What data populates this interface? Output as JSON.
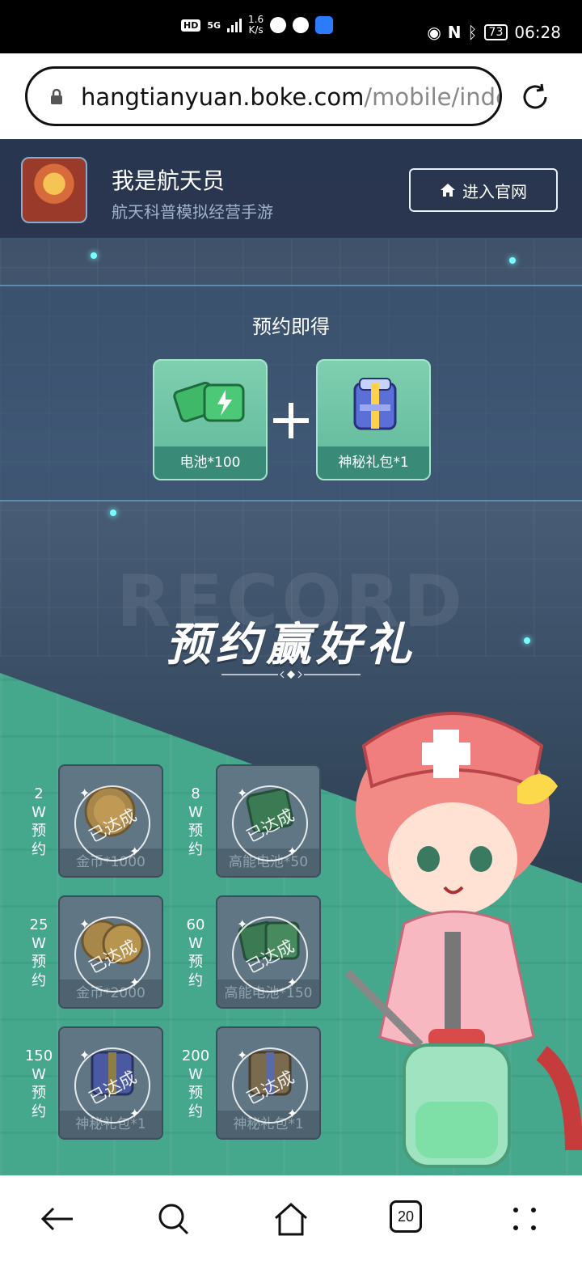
{
  "status_bar": {
    "hd_badge": "HD",
    "network": "5G",
    "speed_value": "1.6",
    "speed_unit": "K/s",
    "battery": "73",
    "time": "06:28"
  },
  "browser": {
    "url_host": "hangtianyuan.boke.com",
    "url_path": "/mobile/inde:",
    "tab_count": "20"
  },
  "site": {
    "app_title": "我是航天员",
    "app_subtitle": "航天科普模拟经营手游",
    "enter_button_label": "进入官网",
    "preorder_title": "预约即得",
    "rewards": [
      {
        "label": "电池*100"
      },
      {
        "label": "神秘礼包*1"
      }
    ],
    "watermark": "RECORD",
    "main_title": "预约赢好礼",
    "stamp_text": "已达成",
    "milestones": [
      {
        "count": "2",
        "unit": "W",
        "line1": "预",
        "line2": "约",
        "reward": "金币*1000"
      },
      {
        "count": "8",
        "unit": "W",
        "line1": "预",
        "line2": "约",
        "reward": "高能电池*50"
      },
      {
        "count": "25",
        "unit": "W",
        "line1": "预",
        "line2": "约",
        "reward": "金币*2000"
      },
      {
        "count": "60",
        "unit": "W",
        "line1": "预",
        "line2": "约",
        "reward": "高能电池*150"
      },
      {
        "count": "150",
        "unit": "W",
        "line1": "预",
        "line2": "约",
        "reward": "神秘礼包*1"
      },
      {
        "count": "200",
        "unit": "W",
        "line1": "预",
        "line2": "约",
        "reward": "神秘礼包*1"
      }
    ]
  },
  "colors": {
    "header_bg": "#28344e",
    "card_green": "#5fb89a",
    "green_zone": "#45a78c",
    "milestone_card": "#617684"
  },
  "icons": [
    "lock-icon",
    "reload-icon",
    "home-icon",
    "plus-icon",
    "back-icon",
    "search-icon",
    "tabs-icon",
    "menu-icon"
  ]
}
